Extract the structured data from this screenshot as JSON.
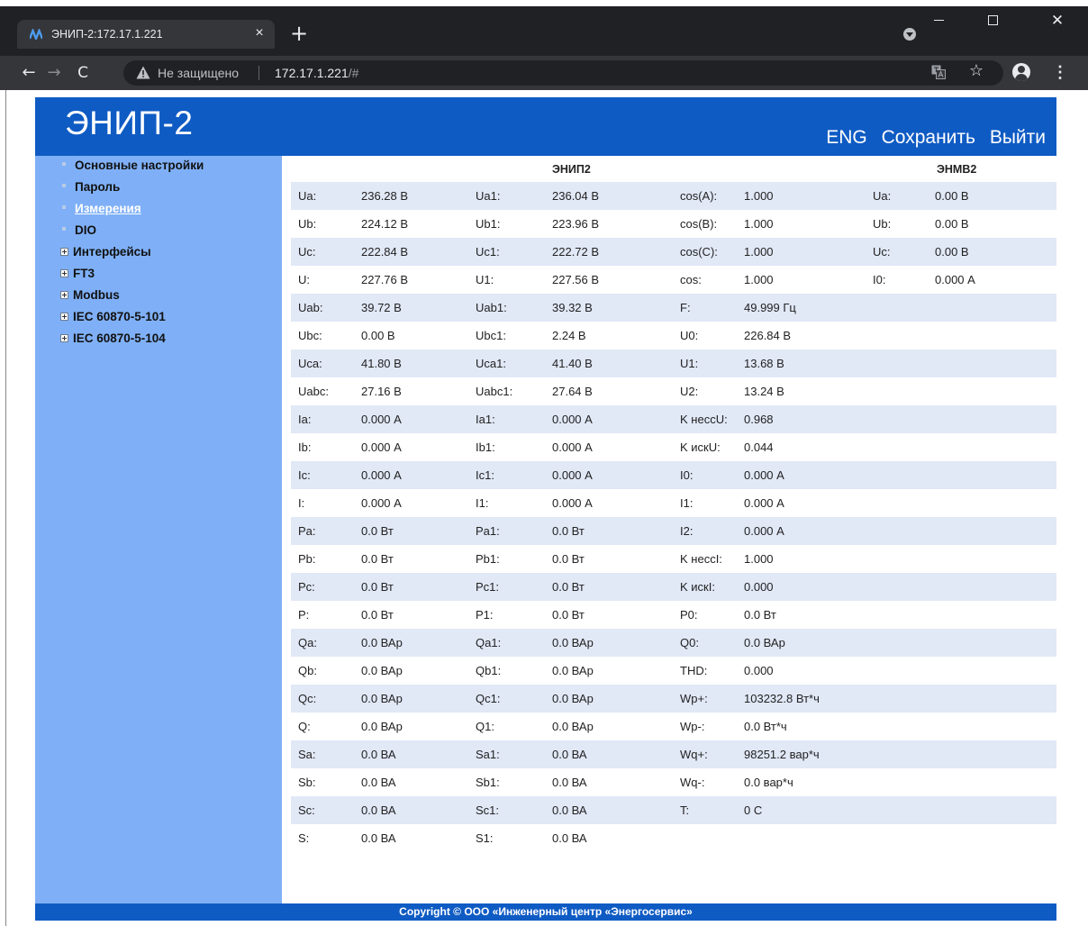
{
  "browser": {
    "tab_title": "ЭНИП-2:172.17.1.221",
    "tab_close": "×",
    "new_tab": "+",
    "insecure_label": "Не защищено",
    "url_host": "172.17.1.221",
    "url_path": "/#",
    "win_close": "✕",
    "back": "←",
    "forward": "→",
    "reload": "C",
    "star": "☆",
    "menu": "⋮"
  },
  "header": {
    "logo": "ЭНИП-2",
    "links": [
      "ENG",
      "Сохранить",
      "Выйти"
    ]
  },
  "sidebar": {
    "items": [
      {
        "label": "Основные настройки",
        "type": "item"
      },
      {
        "label": "Пароль",
        "type": "item"
      },
      {
        "label": "Измерения",
        "type": "item",
        "active": true
      },
      {
        "label": "DIO",
        "type": "item"
      },
      {
        "label": "Интерфейсы",
        "type": "group"
      },
      {
        "label": "FT3",
        "type": "group"
      },
      {
        "label": "Modbus",
        "type": "group"
      },
      {
        "label": "IEC 60870-5-101",
        "type": "group"
      },
      {
        "label": "IEC 60870-5-104",
        "type": "group"
      }
    ]
  },
  "measurements": {
    "section_enip": "ЭНИП2",
    "section_enmv": "ЭНМВ2",
    "rows": [
      {
        "c1": [
          "Ua:",
          "236.28 В"
        ],
        "c2": [
          "Ua1:",
          "236.04 В"
        ],
        "c3": [
          "cos(A):",
          "1.000"
        ],
        "c4": [
          "Ua:",
          "0.00 В"
        ]
      },
      {
        "c1": [
          "Ub:",
          "224.12 В"
        ],
        "c2": [
          "Ub1:",
          "223.96 В"
        ],
        "c3": [
          "cos(B):",
          "1.000"
        ],
        "c4": [
          "Ub:",
          "0.00 В"
        ]
      },
      {
        "c1": [
          "Uc:",
          "222.84 В"
        ],
        "c2": [
          "Uc1:",
          "222.72 В"
        ],
        "c3": [
          "cos(C):",
          "1.000"
        ],
        "c4": [
          "Uc:",
          "0.00 В"
        ]
      },
      {
        "c1": [
          "U:",
          "227.76 В"
        ],
        "c2": [
          "U1:",
          "227.56 В"
        ],
        "c3": [
          "cos:",
          "1.000"
        ],
        "c4": [
          "I0:",
          "0.000 А"
        ]
      },
      {
        "c1": [
          "Uab:",
          "39.72 В"
        ],
        "c2": [
          "Uab1:",
          "39.32 В"
        ],
        "c3": [
          "F:",
          "49.999 Гц"
        ],
        "c4": [
          "",
          ""
        ]
      },
      {
        "c1": [
          "Ubc:",
          "0.00 В"
        ],
        "c2": [
          "Ubc1:",
          "2.24 В"
        ],
        "c3": [
          "U0:",
          "226.84 В"
        ],
        "c4": [
          "",
          ""
        ]
      },
      {
        "c1": [
          "Uca:",
          "41.80 В"
        ],
        "c2": [
          "Uca1:",
          "41.40 В"
        ],
        "c3": [
          "U1:",
          "13.68 В"
        ],
        "c4": [
          "",
          ""
        ]
      },
      {
        "c1": [
          "Uabc:",
          "27.16 В"
        ],
        "c2": [
          "Uabc1:",
          "27.64 В"
        ],
        "c3": [
          "U2:",
          "13.24 В"
        ],
        "c4": [
          "",
          ""
        ]
      },
      {
        "c1": [
          "Ia:",
          "0.000 А"
        ],
        "c2": [
          "Ia1:",
          "0.000 А"
        ],
        "c3": [
          "K неccU:",
          "0.968"
        ],
        "c4": [
          "",
          ""
        ]
      },
      {
        "c1": [
          "Ib:",
          "0.000 А"
        ],
        "c2": [
          "Ib1:",
          "0.000 А"
        ],
        "c3": [
          "K искU:",
          "0.044"
        ],
        "c4": [
          "",
          ""
        ]
      },
      {
        "c1": [
          "Ic:",
          "0.000 А"
        ],
        "c2": [
          "Ic1:",
          "0.000 А"
        ],
        "c3": [
          "I0:",
          "0.000 А"
        ],
        "c4": [
          "",
          ""
        ]
      },
      {
        "c1": [
          "I:",
          "0.000 А"
        ],
        "c2": [
          "I1:",
          "0.000 А"
        ],
        "c3": [
          "I1:",
          "0.000 А"
        ],
        "c4": [
          "",
          ""
        ]
      },
      {
        "c1": [
          "Pa:",
          "0.0 Вт"
        ],
        "c2": [
          "Pa1:",
          "0.0 Вт"
        ],
        "c3": [
          "I2:",
          "0.000 А"
        ],
        "c4": [
          "",
          ""
        ]
      },
      {
        "c1": [
          "Pb:",
          "0.0 Вт"
        ],
        "c2": [
          "Pb1:",
          "0.0 Вт"
        ],
        "c3": [
          "K неccI:",
          "1.000"
        ],
        "c4": [
          "",
          ""
        ]
      },
      {
        "c1": [
          "Pc:",
          "0.0 Вт"
        ],
        "c2": [
          "Pc1:",
          "0.0 Вт"
        ],
        "c3": [
          "K искI:",
          "0.000"
        ],
        "c4": [
          "",
          ""
        ]
      },
      {
        "c1": [
          "P:",
          "0.0 Вт"
        ],
        "c2": [
          "P1:",
          "0.0 Вт"
        ],
        "c3": [
          "P0:",
          "0.0 Вт"
        ],
        "c4": [
          "",
          ""
        ]
      },
      {
        "c1": [
          "Qa:",
          "0.0 ВАр"
        ],
        "c2": [
          "Qa1:",
          "0.0 ВАр"
        ],
        "c3": [
          "Q0:",
          "0.0 ВАр"
        ],
        "c4": [
          "",
          ""
        ]
      },
      {
        "c1": [
          "Qb:",
          "0.0 ВАр"
        ],
        "c2": [
          "Qb1:",
          "0.0 ВАр"
        ],
        "c3": [
          "THD:",
          "0.000"
        ],
        "c4": [
          "",
          ""
        ]
      },
      {
        "c1": [
          "Qc:",
          "0.0 ВАр"
        ],
        "c2": [
          "Qc1:",
          "0.0 ВАр"
        ],
        "c3": [
          "Wp+:",
          "103232.8 Вт*ч"
        ],
        "c4": [
          "",
          ""
        ]
      },
      {
        "c1": [
          "Q:",
          "0.0 ВАр"
        ],
        "c2": [
          "Q1:",
          "0.0 ВАр"
        ],
        "c3": [
          "Wp-:",
          "0.0 Вт*ч"
        ],
        "c4": [
          "",
          ""
        ]
      },
      {
        "c1": [
          "Sa:",
          "0.0 ВА"
        ],
        "c2": [
          "Sa1:",
          "0.0 ВА"
        ],
        "c3": [
          "Wq+:",
          "98251.2 вар*ч"
        ],
        "c4": [
          "",
          ""
        ]
      },
      {
        "c1": [
          "Sb:",
          "0.0 ВА"
        ],
        "c2": [
          "Sb1:",
          "0.0 ВА"
        ],
        "c3": [
          "Wq-:",
          "0.0 вар*ч"
        ],
        "c4": [
          "",
          ""
        ]
      },
      {
        "c1": [
          "Sc:",
          "0.0 ВА"
        ],
        "c2": [
          "Sc1:",
          "0.0 ВА"
        ],
        "c3": [
          "T:",
          "0 C"
        ],
        "c4": [
          "",
          ""
        ]
      },
      {
        "c1": [
          "S:",
          "0.0 ВА"
        ],
        "c2": [
          "S1:",
          "0.0 ВА"
        ],
        "c3": [
          "",
          ""
        ],
        "c4": [
          "",
          ""
        ]
      }
    ]
  },
  "footer": {
    "copyright": "Copyright © ООО «Инженерный центр «Энергосервис»"
  },
  "colors": {
    "header_blue": "#0f5bc4",
    "sidebar_blue": "#7fb0f7",
    "row_shade": "#e1e8f6"
  }
}
